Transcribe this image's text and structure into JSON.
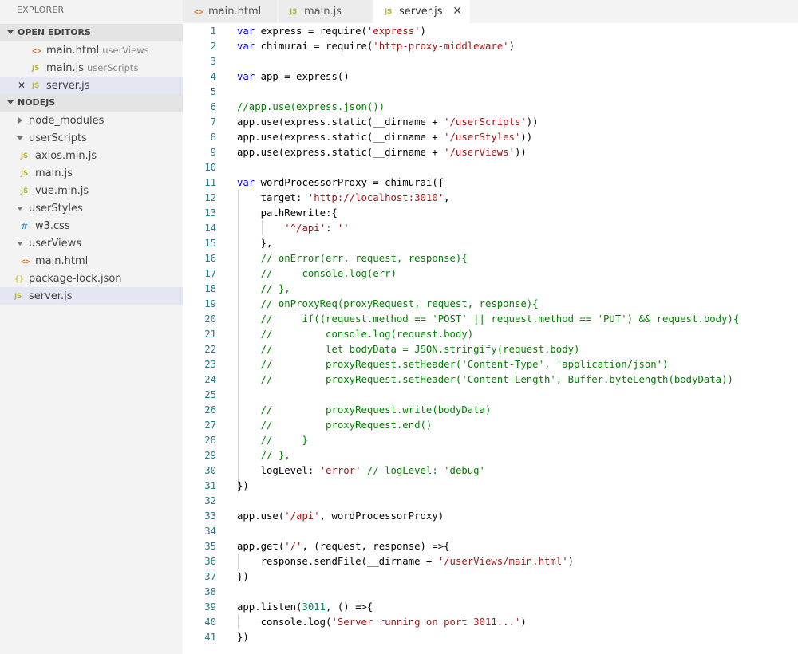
{
  "explorer": {
    "title": "EXPLORER",
    "open_editors": {
      "header": "OPEN EDITORS",
      "items": [
        {
          "icon": "html-file-icon",
          "label": "main.html",
          "desc": "userViews"
        },
        {
          "icon": "js-file-icon",
          "label": "main.js",
          "desc": "userScripts"
        },
        {
          "icon": "js-file-icon",
          "label": "server.js",
          "desc": ""
        }
      ]
    },
    "project": {
      "header": "NODEJS",
      "items": [
        {
          "label": "node_modules"
        },
        {
          "label": "userScripts"
        },
        {
          "label": "axios.min.js"
        },
        {
          "label": "main.js"
        },
        {
          "label": "vue.min.js"
        },
        {
          "label": "userStyles"
        },
        {
          "label": "w3.css"
        },
        {
          "label": "userViews"
        },
        {
          "label": "main.html"
        },
        {
          "label": "package-lock.json"
        },
        {
          "label": "server.js"
        }
      ]
    }
  },
  "icons": {
    "js": "JS",
    "html": "<>",
    "css": "#",
    "json": "{}",
    "close": "✕"
  },
  "tabs": [
    {
      "label": "main.html",
      "icon": "html-file-icon"
    },
    {
      "label": "main.js",
      "icon": "js-file-icon"
    },
    {
      "label": "server.js",
      "icon": "js-file-icon",
      "active": true
    }
  ],
  "colors": {
    "keyword": "#0000ff",
    "string": "#a31515",
    "comment": "#008000",
    "number": "#09885a",
    "line_number": "#237893"
  },
  "code_lines": [
    "var express = require('express')",
    "var chimurai = require('http-proxy-middleware')",
    "",
    "var app = express()",
    "",
    "//app.use(express.json())",
    "app.use(express.static(__dirname + '/userScripts'))",
    "app.use(express.static(__dirname + '/userStyles'))",
    "app.use(express.static(__dirname + '/userViews'))",
    "",
    "var wordProcessorProxy = chimurai({",
    "    target: 'http://localhost:3010',",
    "    pathRewrite:{",
    "        '^/api': ''",
    "    },",
    "    // onError(err, request, response){",
    "    //     console.log(err)",
    "    // },",
    "    // onProxyReq(proxyRequest, request, response){",
    "    //     if((request.method == 'POST' || request.method == 'PUT') && request.body){",
    "    //         console.log(request.body)",
    "    //         let bodyData = JSON.stringify(request.body)",
    "    //         proxyRequest.setHeader('Content-Type', 'application/json')",
    "    //         proxyRequest.setHeader('Content-Length', Buffer.byteLength(bodyData))",
    "",
    "    //         proxyRequest.write(bodyData)",
    "    //         proxyRequest.end()",
    "    //     }",
    "    // },",
    "    logLevel: 'error' // logLevel: 'debug'",
    "})",
    "",
    "app.use('/api', wordProcessorProxy)",
    "",
    "app.get('/', (request, response) =>{",
    "    response.sendFile(__dirname + '/userViews/main.html')",
    "})",
    "",
    "app.listen(3011, () =>{",
    "    console.log('Server running on port 3011...')",
    "})"
  ]
}
